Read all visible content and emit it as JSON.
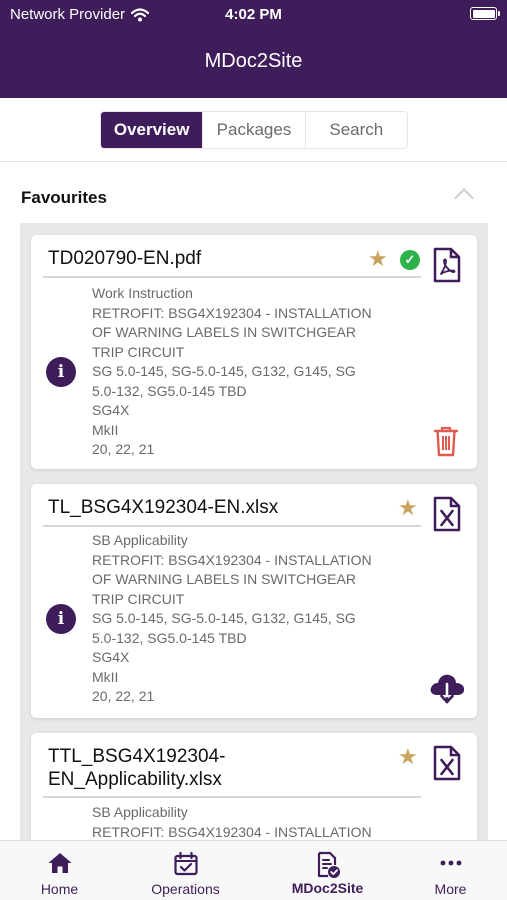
{
  "status_bar": {
    "carrier": "Network Provider",
    "time": "4:02 PM"
  },
  "app": {
    "title": "MDoc2Site"
  },
  "segments": [
    {
      "label": "Overview",
      "active": true
    },
    {
      "label": "Packages",
      "active": false
    },
    {
      "label": "Search",
      "active": false
    }
  ],
  "favourites": {
    "title": "Favourites",
    "cards": [
      {
        "filename": "TD020790-EN.pdf",
        "doc_type": "pdf",
        "details": [
          "Work Instruction",
          "RETROFIT: BSG4X192304 - INSTALLATION",
          "OF  WARNING LABELS IN SWITCHGEAR",
          "TRIP  CIRCUIT",
          "SG 5.0-145, SG-5.0-145, G132, G145, SG",
          "5.0-132, SG5.0-145 TBD",
          "SG4X",
          "MkII",
          "20, 22, 21"
        ],
        "favourite": true,
        "downloaded": true,
        "action": "trash-icon"
      },
      {
        "filename": "TL_BSG4X192304-EN.xlsx",
        "doc_type": "xlsx",
        "details": [
          "SB Applicability",
          "RETROFIT: BSG4X192304 - INSTALLATION",
          "OF  WARNING LABELS IN SWITCHGEAR",
          "TRIP  CIRCUIT",
          "SG 5.0-145, SG-5.0-145, G132, G145, SG",
          "5.0-132, SG5.0-145 TBD",
          "SG4X",
          "MkII",
          "20, 22, 21"
        ],
        "favourite": true,
        "downloaded": false,
        "action": "cloud-download-icon"
      },
      {
        "filename_lines": [
          "TTL_BSG4X192304-",
          "EN_Applicability.xlsx"
        ],
        "doc_type": "xlsx",
        "details": [
          "SB Applicability",
          "RETROFIT: BSG4X192304 - INSTALLATION"
        ],
        "favourite": true
      }
    ]
  },
  "tabbar": [
    {
      "label": "Home",
      "icon": "home-icon",
      "active": false
    },
    {
      "label": "Operations",
      "icon": "calendar-check-icon",
      "active": false
    },
    {
      "label": "MDoc2Site",
      "icon": "document-check-icon",
      "active": true
    },
    {
      "label": "More",
      "icon": "more-dots-icon",
      "active": false
    }
  ],
  "colors": {
    "primary": "#3f1d5a",
    "star": "#c9a45f",
    "check": "#2db24a",
    "trash": "#e05a4f"
  }
}
